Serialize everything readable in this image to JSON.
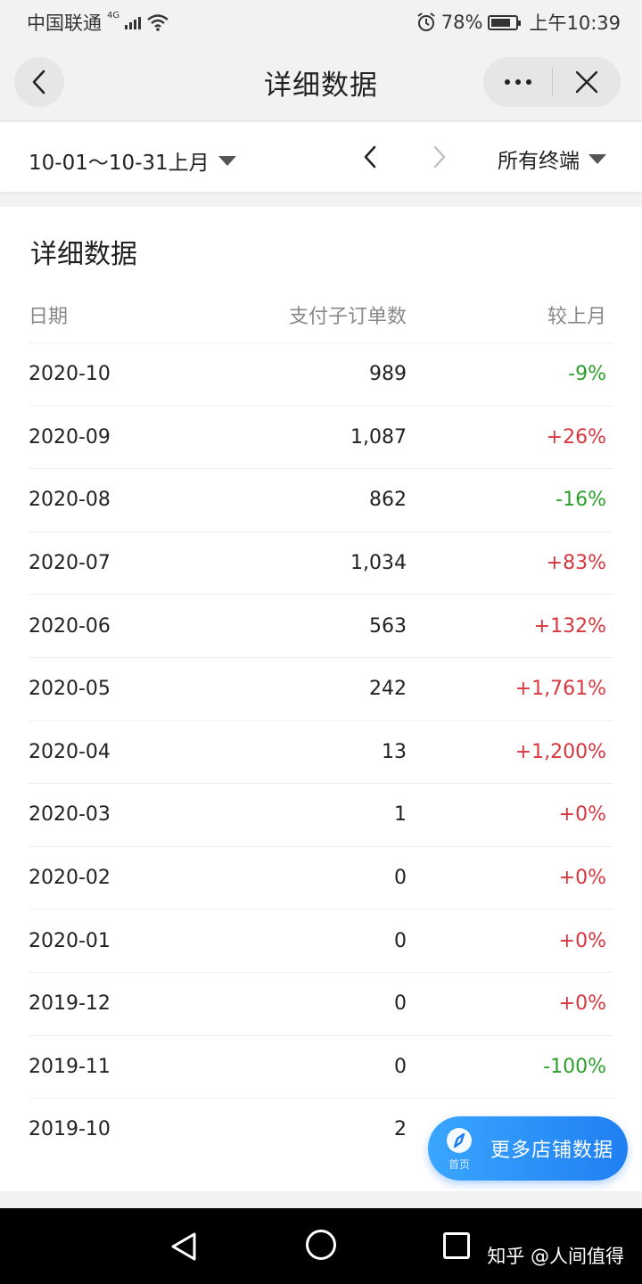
{
  "status": {
    "carrier": "中国联通",
    "network": "4G",
    "battery": "78%",
    "time": "上午10:39"
  },
  "nav": {
    "title": "详细数据"
  },
  "filter": {
    "date_range": "10-01～10-31上月",
    "terminal": "所有终端"
  },
  "card": {
    "title": "详细数据",
    "headers": {
      "date": "日期",
      "orders": "支付子订单数",
      "vs_last": "较上月"
    },
    "rows": [
      {
        "date": "2020-10",
        "orders": "989",
        "change": "-9%",
        "trend": "down"
      },
      {
        "date": "2020-09",
        "orders": "1,087",
        "change": "+26%",
        "trend": "up"
      },
      {
        "date": "2020-08",
        "orders": "862",
        "change": "-16%",
        "trend": "down"
      },
      {
        "date": "2020-07",
        "orders": "1,034",
        "change": "+83%",
        "trend": "up"
      },
      {
        "date": "2020-06",
        "orders": "563",
        "change": "+132%",
        "trend": "up"
      },
      {
        "date": "2020-05",
        "orders": "242",
        "change": "+1,761%",
        "trend": "up"
      },
      {
        "date": "2020-04",
        "orders": "13",
        "change": "+1,200%",
        "trend": "up"
      },
      {
        "date": "2020-03",
        "orders": "1",
        "change": "+0%",
        "trend": "up"
      },
      {
        "date": "2020-02",
        "orders": "0",
        "change": "+0%",
        "trend": "up"
      },
      {
        "date": "2020-01",
        "orders": "0",
        "change": "+0%",
        "trend": "up"
      },
      {
        "date": "2019-12",
        "orders": "0",
        "change": "+0%",
        "trend": "up"
      },
      {
        "date": "2019-11",
        "orders": "0",
        "change": "-100%",
        "trend": "down"
      },
      {
        "date": "2019-10",
        "orders": "2",
        "change": "",
        "trend": "up"
      }
    ]
  },
  "float_button": {
    "home_label": "首页",
    "text": "更多店铺数据"
  },
  "watermark": "知乎 @人间值得",
  "colors": {
    "up": "#d9363e",
    "down": "#2aa02a",
    "accent": "#1f7ff2"
  }
}
